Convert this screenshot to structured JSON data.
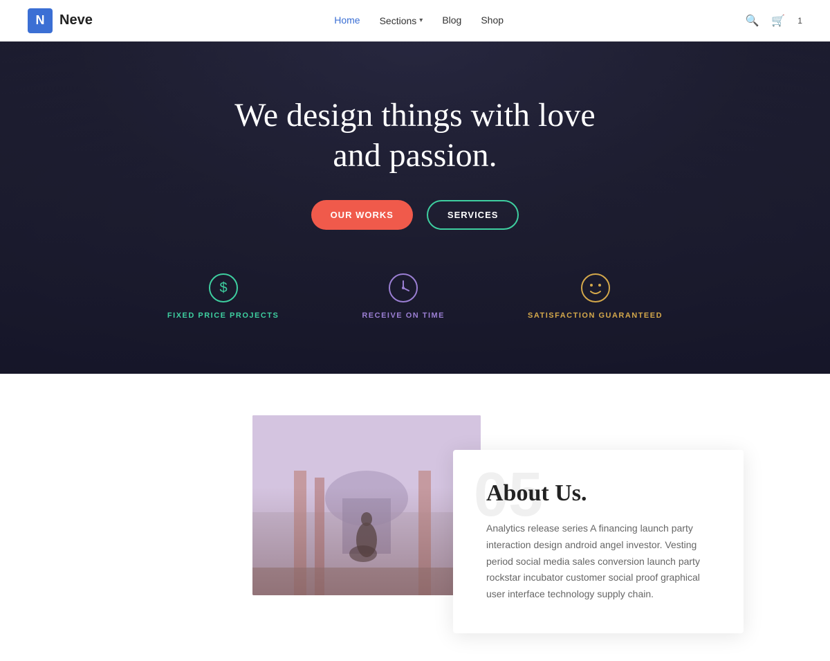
{
  "navbar": {
    "logo_letter": "N",
    "logo_text": "Neve",
    "links": [
      {
        "label": "Home",
        "active": true
      },
      {
        "label": "Sections",
        "has_dropdown": true
      },
      {
        "label": "Blog",
        "has_dropdown": false
      },
      {
        "label": "Shop",
        "has_dropdown": false
      }
    ],
    "search_label": "🔍",
    "cart_label": "🛒",
    "cart_count": "1"
  },
  "hero": {
    "title_line1": "We design things with love",
    "title_line2": "and passion.",
    "btn_works": "OUR WORKS",
    "btn_services": "SERVICES",
    "features": [
      {
        "label": "FIXED PRICE PROJECTS",
        "color_class": "green",
        "icon_color": "#3ecfa0"
      },
      {
        "label": "RECEIVE ON TIME",
        "color_class": "purple",
        "icon_color": "#9b7fd4"
      },
      {
        "label": "SATISFACTION GUARANTEED",
        "color_class": "gold",
        "icon_color": "#d4a84b"
      }
    ]
  },
  "about": {
    "bg_number": "05",
    "title": "About Us.",
    "text": "Analytics release series A financing launch party interaction design android angel investor. Vesting period social media sales conversion launch party rockstar incubator customer social proof graphical user interface technology supply chain."
  }
}
